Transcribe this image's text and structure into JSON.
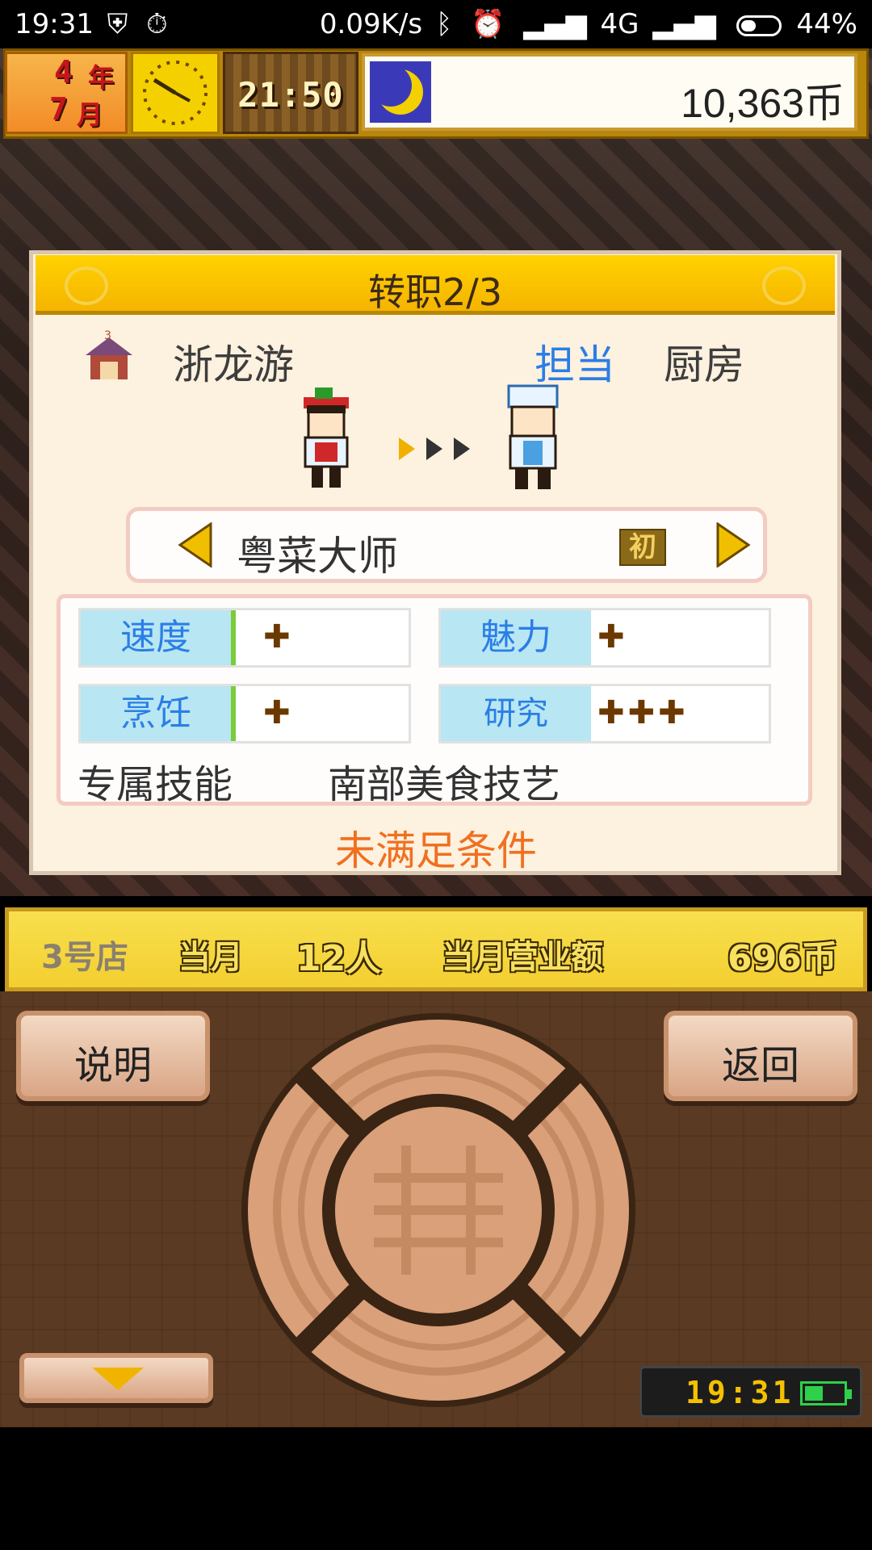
{
  "status_bar": {
    "time": "19:31",
    "network_speed": "0.09K/s",
    "network_type": "4G",
    "battery": "44%",
    "icons": [
      "shield-bolt-icon",
      "stopwatch-icon",
      "bluetooth-icon",
      "alarm-icon",
      "signal-icon",
      "battery-icon"
    ]
  },
  "hud": {
    "year_num": "4",
    "year_unit": "年",
    "month_num": "7",
    "month_unit": "月",
    "time": "21:50",
    "money": "10,363币",
    "weather_icon": "moon-icon"
  },
  "dialog": {
    "title": "转职2/3",
    "staff_name": "浙龙游",
    "role_label": "担当",
    "role_value": "厨房",
    "job": {
      "name": "粤菜大师",
      "badge": "初"
    },
    "stats": [
      {
        "label": "速度",
        "value": "✚"
      },
      {
        "label": "魅力",
        "value": "✚"
      },
      {
        "label": "烹饪",
        "value": "✚"
      },
      {
        "label": "研究",
        "value": "✚✚✚"
      }
    ],
    "skill_label": "专属技能",
    "skill_value": "南部美食技艺",
    "condition_text": "未满足条件"
  },
  "shop_bar": {
    "store": "3号店",
    "month_label": "当月",
    "customers": "12人",
    "revenue_label": "当月营业额",
    "revenue": "696币"
  },
  "controls": {
    "explain_label": "说明",
    "back_label": "返回",
    "handheld_time": "19:31"
  },
  "colors": {
    "accent_blue": "#2a7ee6",
    "condition_orange": "#f07020",
    "header_yellow": "#ffd200"
  }
}
